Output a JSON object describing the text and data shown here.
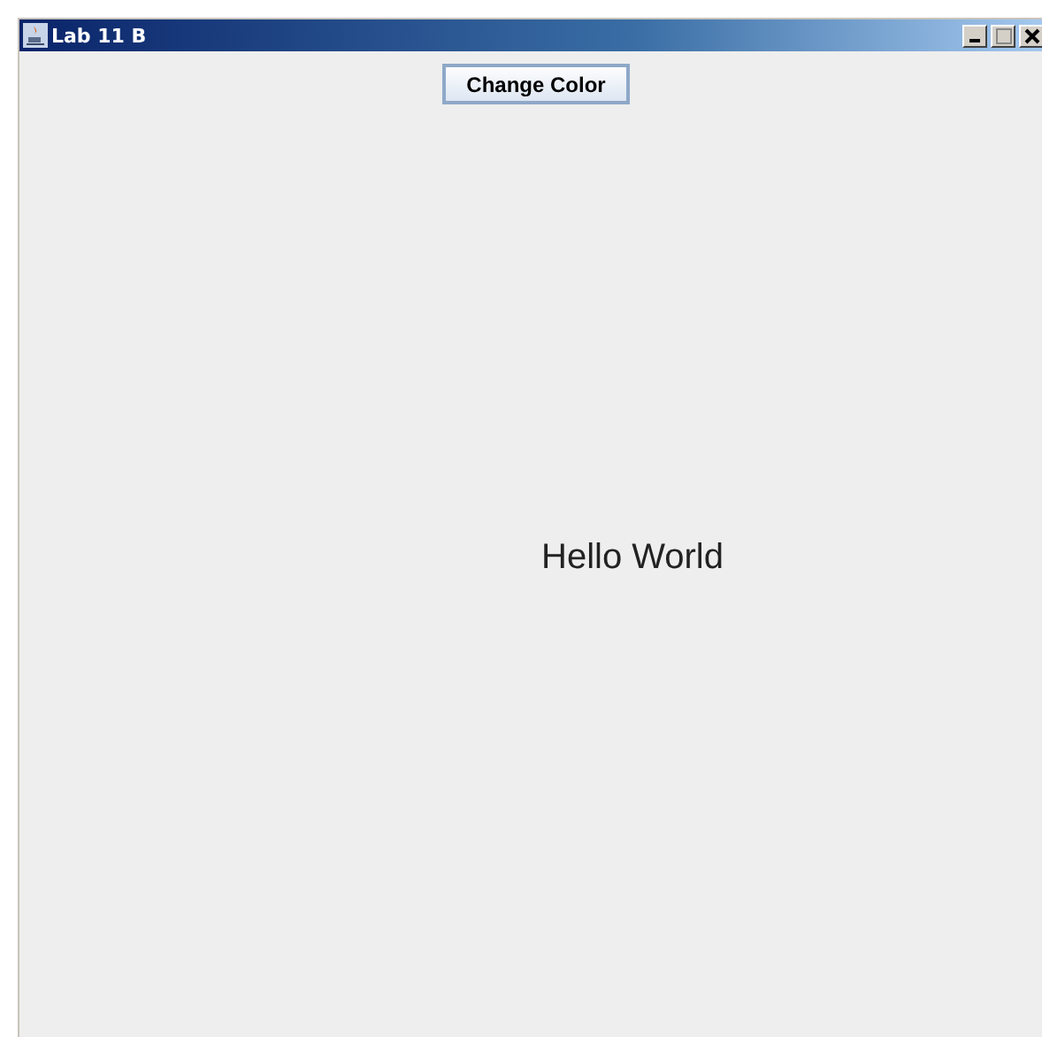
{
  "window": {
    "title": "Lab 11 B"
  },
  "button": {
    "label": "Change Color"
  },
  "canvas_text": "Hello World"
}
